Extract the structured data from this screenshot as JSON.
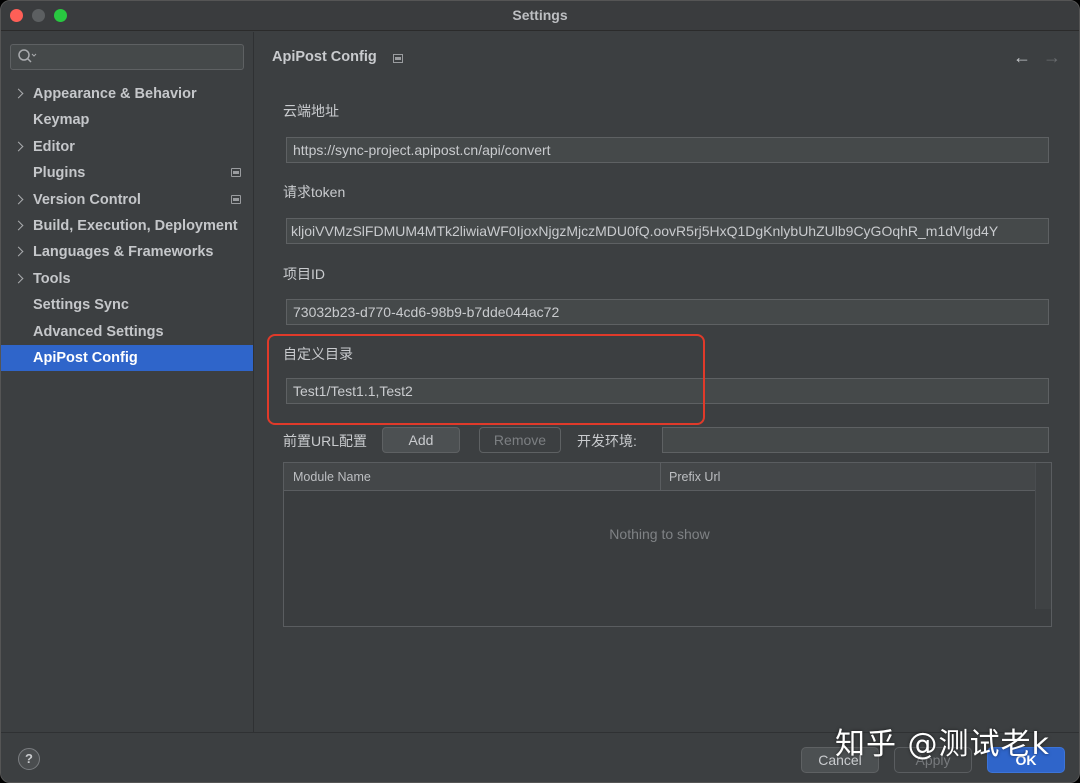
{
  "window": {
    "title": "Settings"
  },
  "sidebar": {
    "search": {
      "placeholder": ""
    },
    "items": [
      {
        "label": "Appearance & Behavior",
        "expandable": true
      },
      {
        "label": "Keymap",
        "expandable": false
      },
      {
        "label": "Editor",
        "expandable": true
      },
      {
        "label": "Plugins",
        "expandable": false,
        "badge": true
      },
      {
        "label": "Version Control",
        "expandable": true,
        "badge": true
      },
      {
        "label": "Build, Execution, Deployment",
        "expandable": true
      },
      {
        "label": "Languages & Frameworks",
        "expandable": true
      },
      {
        "label": "Tools",
        "expandable": true
      },
      {
        "label": "Settings Sync",
        "expandable": false
      },
      {
        "label": "Advanced Settings",
        "expandable": false
      },
      {
        "label": "ApiPost Config",
        "expandable": false,
        "active": true
      }
    ]
  },
  "main": {
    "title": "ApiPost Config",
    "fields": {
      "cloud_url": {
        "label": "云端地址",
        "value": "https://sync-project.apipost.cn/api/convert"
      },
      "token": {
        "label": "请求token",
        "value": "kljoiVVMzSlFDMUM4MTk2liwiaWF0IjoxNjgzMjczMDU0fQ.oovR5rj5HxQ1DgKnlybUhZUlb9CyGOqhR_m1dVlgd4Y"
      },
      "project_id": {
        "label": "项目ID",
        "value": "73032b23-d770-4cd6-98b9-b7dde044ac72"
      },
      "custom_dir": {
        "label": "自定义目录",
        "value": "Test1/Test1.1,Test2"
      }
    },
    "prefix_url": {
      "label": "前置URL配置",
      "add_label": "Add",
      "remove_label": "Remove",
      "env_label": "开发环境:",
      "env_value": ""
    },
    "table": {
      "columns": [
        "Module Name",
        "Prefix Url"
      ],
      "rows": [],
      "empty_text": "Nothing to show"
    }
  },
  "footer": {
    "help_label": "?",
    "cancel_label": "Cancel",
    "apply_label": "Apply",
    "ok_label": "OK"
  },
  "watermark": "知乎 @测试老k",
  "colors": {
    "accent": "#2f65ca",
    "highlight_border": "#e03a2a",
    "close": "#fe5f57",
    "maximize": "#28c840"
  }
}
